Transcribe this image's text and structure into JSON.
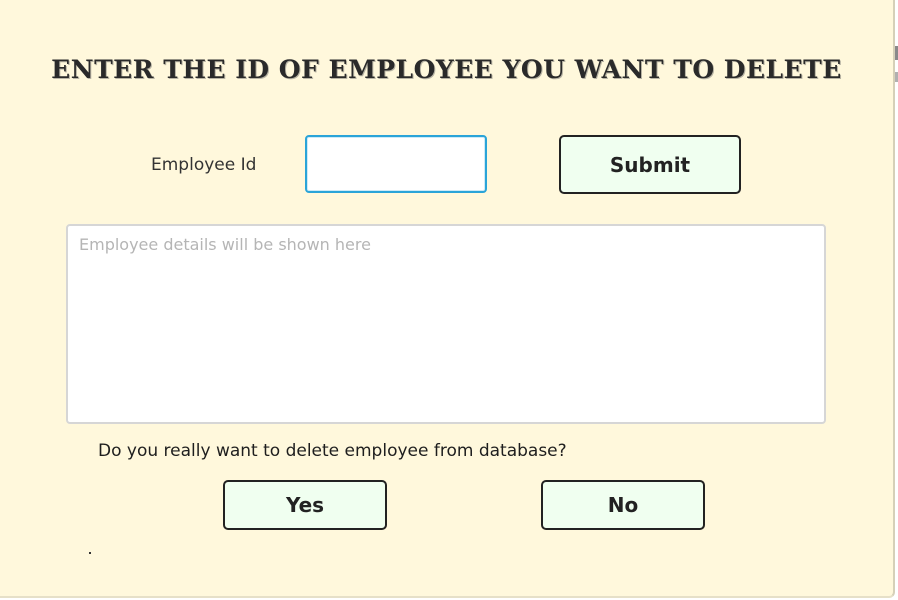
{
  "dialog": {
    "title": "Enter the id of employee you want to delete"
  },
  "form": {
    "id_label": "Employee Id",
    "id_value": "",
    "submit_label": "Submit"
  },
  "details": {
    "placeholder": "Employee details will be shown here",
    "value": ""
  },
  "confirm": {
    "question": "Do you really want to delete employee from database?",
    "yes_label": "Yes",
    "no_label": "No",
    "footer_text": "."
  },
  "colors": {
    "background": "#fff8dc",
    "button_bg": "#f0fff0",
    "input_focus_border": "#2aa4d8"
  }
}
